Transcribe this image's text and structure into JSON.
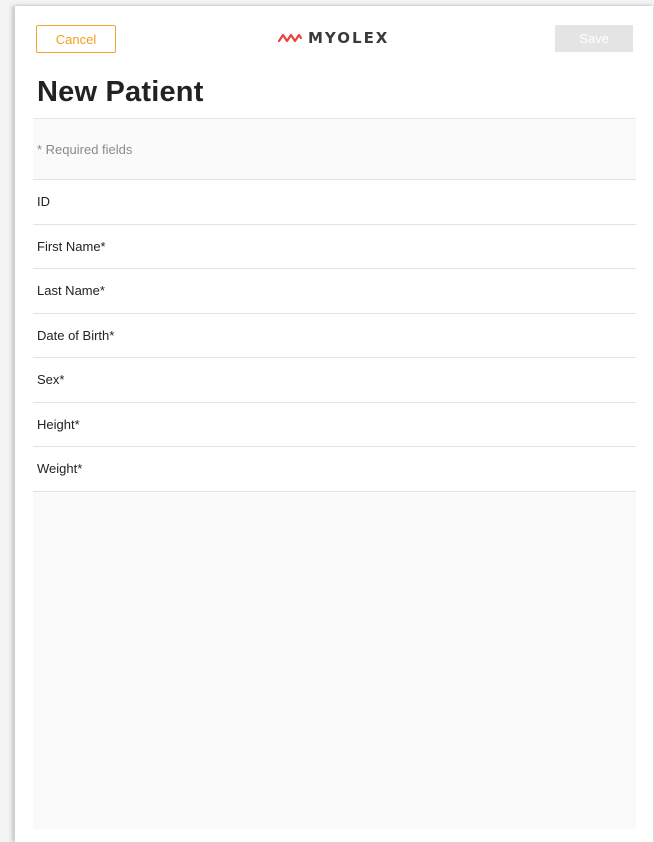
{
  "header": {
    "cancel_label": "Cancel",
    "brand_name": "MYOLEX",
    "save_label": "Save"
  },
  "page": {
    "title": "New Patient",
    "required_note": "* Required fields"
  },
  "fields": [
    {
      "label": "ID"
    },
    {
      "label": "First Name*"
    },
    {
      "label": "Last Name*"
    },
    {
      "label": "Date of Birth*"
    },
    {
      "label": "Sex*"
    },
    {
      "label": "Height*"
    },
    {
      "label": "Weight*"
    }
  ],
  "colors": {
    "accent_orange": "#f39c1f",
    "brand_red": "#e8403a",
    "disabled_button": "#e4e4e4"
  },
  "icons": {
    "logo": "myolex-wave-logo-icon"
  }
}
